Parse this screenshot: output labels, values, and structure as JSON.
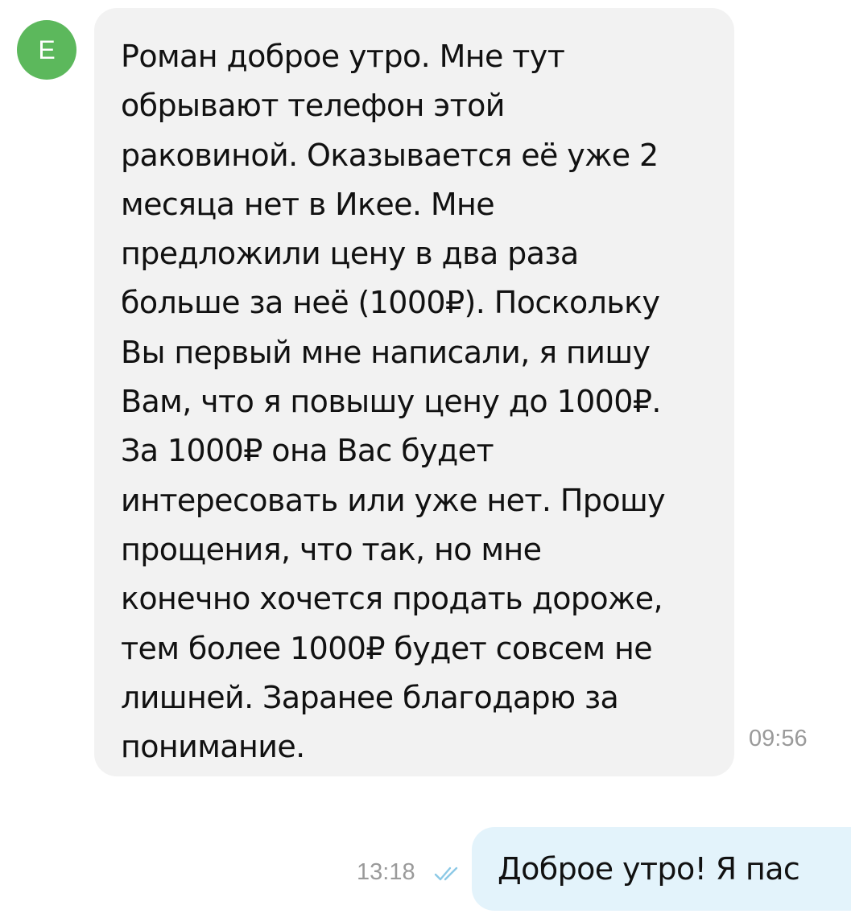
{
  "incoming": {
    "avatar_letter": "E",
    "text": "Роман доброе утро. Мне тут\nобрывают телефон этой\nраковиной. Оказывается её уже 2\nмесяца нет в Икее. Мне\nпредложили цену в два раза\nбольше за неё (1000₽). Поскольку\nВы первый мне написали, я пишу\nВам, что я повышу цену до 1000₽.\nЗа 1000₽ она Вас будет\nинтересовать или уже нет. Прошу\nпрощения, что так, но мне\nконечно хочется продать дороже,\nтем более 1000₽ будет совсем не\nлишней. Заранее благодарю за\nпонимание.",
    "time": "09:56"
  },
  "outgoing": {
    "text": "Доброе утро! Я пас",
    "time": "13:18",
    "status_icon": "double-check-icon"
  },
  "colors": {
    "avatar_bg": "#5cb85c",
    "incoming_bubble": "#f2f2f2",
    "outgoing_bubble": "#e3f3fb",
    "check": "#8cc9e6"
  }
}
